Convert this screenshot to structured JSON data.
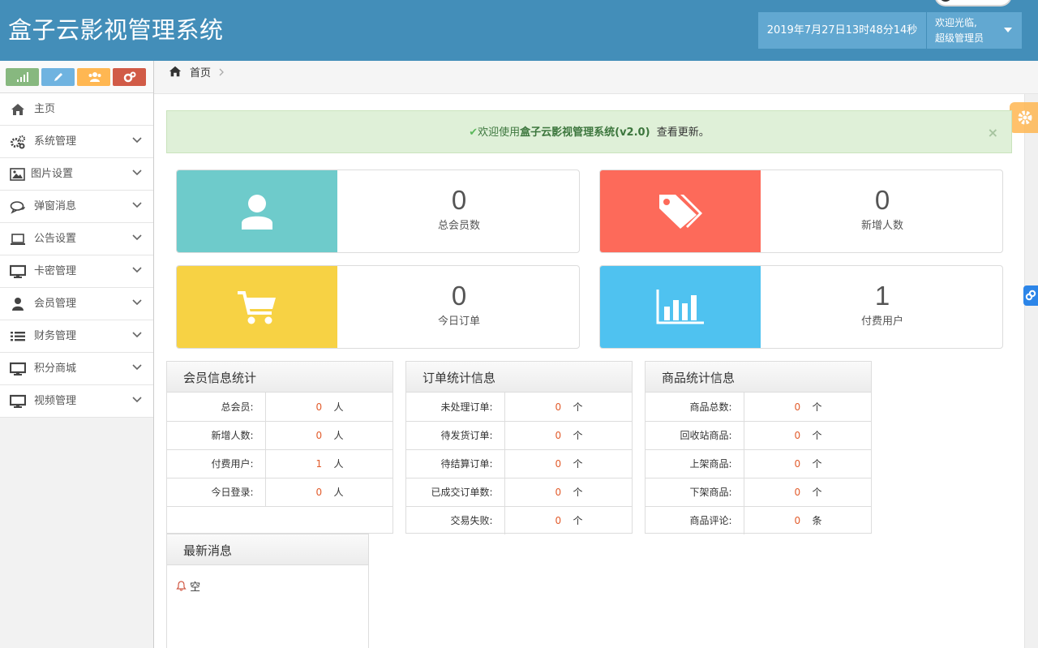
{
  "navbar": {
    "brand": "盒子云影视管理系统",
    "datetime": "2019年7月27日13时48分14秒",
    "welcome": "欢迎光临,",
    "user_role": "超级管理员"
  },
  "breadcrumb": {
    "home": "首页"
  },
  "sidebar": {
    "shortcut_colors": [
      "#87b87f",
      "#6fb3e0",
      "#ffb752",
      "#d15b47"
    ],
    "items": [
      {
        "label": "主页",
        "icon": "home-icon"
      },
      {
        "label": "系统管理",
        "icon": "cogs-icon"
      },
      {
        "label": "图片设置",
        "icon": "picture-icon"
      },
      {
        "label": "弹窗消息",
        "icon": "comments-icon"
      },
      {
        "label": "公告设置",
        "icon": "laptop-icon"
      },
      {
        "label": "卡密管理",
        "icon": "desktop-icon"
      },
      {
        "label": "会员管理",
        "icon": "user-icon"
      },
      {
        "label": "财务管理",
        "icon": "list-icon"
      },
      {
        "label": "积分商城",
        "icon": "desktop-icon"
      },
      {
        "label": "视频管理",
        "icon": "desktop-icon"
      }
    ]
  },
  "alert": {
    "prefix": "欢迎使用",
    "product": "盒子云影视管理系统(v2.0)",
    "suffix": "查看更新。",
    "close": "×"
  },
  "stats": [
    {
      "value": "0",
      "label": "总会员数",
      "color": "#6ecbcb",
      "icon": "user-icon"
    },
    {
      "value": "0",
      "label": "新增人数",
      "color": "#fd6a5a",
      "icon": "tags-icon"
    },
    {
      "value": "0",
      "label": "今日订单",
      "color": "#f7d244",
      "icon": "cart-icon"
    },
    {
      "value": "1",
      "label": "付费用户",
      "color": "#4fc2f0",
      "icon": "bar-chart-icon"
    }
  ],
  "member_stats": {
    "title": "会员信息统计",
    "rows": [
      {
        "key": "总会员:",
        "value": "0",
        "unit": "人"
      },
      {
        "key": "新增人数:",
        "value": "0",
        "unit": "人"
      },
      {
        "key": "付费用户:",
        "value": "1",
        "unit": "人"
      },
      {
        "key": "今日登录:",
        "value": "0",
        "unit": "人"
      }
    ]
  },
  "order_stats": {
    "title": "订单统计信息",
    "rows": [
      {
        "key": "未处理订单:",
        "value": "0",
        "unit": "个"
      },
      {
        "key": "待发货订单:",
        "value": "0",
        "unit": "个"
      },
      {
        "key": "待结算订单:",
        "value": "0",
        "unit": "个"
      },
      {
        "key": "已成交订单数:",
        "value": "0",
        "unit": "个"
      },
      {
        "key": "交易失败:",
        "value": "0",
        "unit": "个"
      }
    ]
  },
  "product_stats": {
    "title": "商品统计信息",
    "rows": [
      {
        "key": "商品总数:",
        "value": "0",
        "unit": "个"
      },
      {
        "key": "回收站商品:",
        "value": "0",
        "unit": "个"
      },
      {
        "key": "上架商品:",
        "value": "0",
        "unit": "个"
      },
      {
        "key": "下架商品:",
        "value": "0",
        "unit": "个"
      },
      {
        "key": "商品评论:",
        "value": "0",
        "unit": "条"
      }
    ]
  },
  "messages": {
    "title": "最新消息",
    "empty": "空"
  }
}
